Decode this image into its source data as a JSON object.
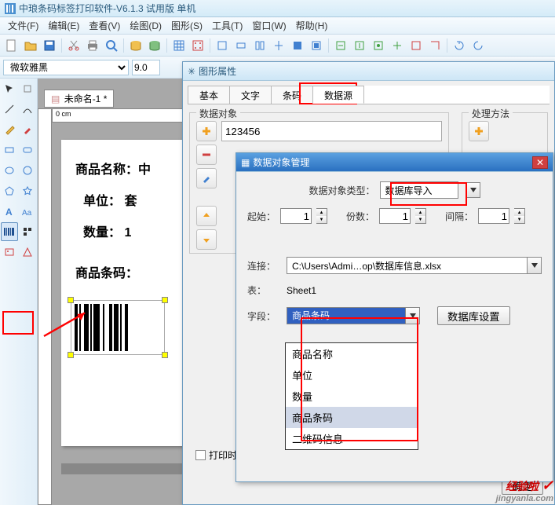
{
  "app": {
    "title": "中琅条码标签打印软件-V6.1.3 试用版 单机"
  },
  "menu": {
    "file": "文件(F)",
    "edit": "编辑(E)",
    "view": "查看(V)",
    "draw": "绘图(D)",
    "shape": "图形(S)",
    "tool": "工具(T)",
    "window": "窗口(W)",
    "help": "帮助(H)"
  },
  "fontbar": {
    "font_name": "微软雅黑",
    "font_size": "9.0"
  },
  "document": {
    "tab_name": "未命名-1 *",
    "ruler_label": "0  cm"
  },
  "label": {
    "line1": "商品名称：中",
    "line2": "单位：  套",
    "line3": "数量：  1",
    "line4": "商品条码："
  },
  "dialog1": {
    "title": "图形属性",
    "tabs": {
      "basic": "基本",
      "text": "文字",
      "barcode": "条码",
      "datasource": "数据源"
    },
    "group_data": "数据对象",
    "group_method": "处理方法",
    "data_value": "123456",
    "print_save": "打印时保存",
    "ok": "确定"
  },
  "dialog2": {
    "title": "数据对象管理",
    "type_label": "数据对象类型：",
    "type_value": "数据库导入",
    "start_label": "起始：",
    "start_value": "1",
    "count_label": "份数：",
    "count_value": "1",
    "interval_label": "间隔：",
    "interval_value": "1",
    "connect_label": "连接：",
    "connect_value": "C:\\Users\\Admi…op\\数据库信息.xlsx",
    "table_label": "表：",
    "table_value": "Sheet1",
    "field_label": "字段：",
    "field_selected": "商品条码",
    "field_options": [
      "商品名称",
      "单位",
      "数量",
      "商品条码",
      "二维码信息"
    ],
    "db_settings": "数据库设置"
  },
  "watermark": {
    "text1": "经验啦",
    "text2": "jingyanla.com"
  }
}
